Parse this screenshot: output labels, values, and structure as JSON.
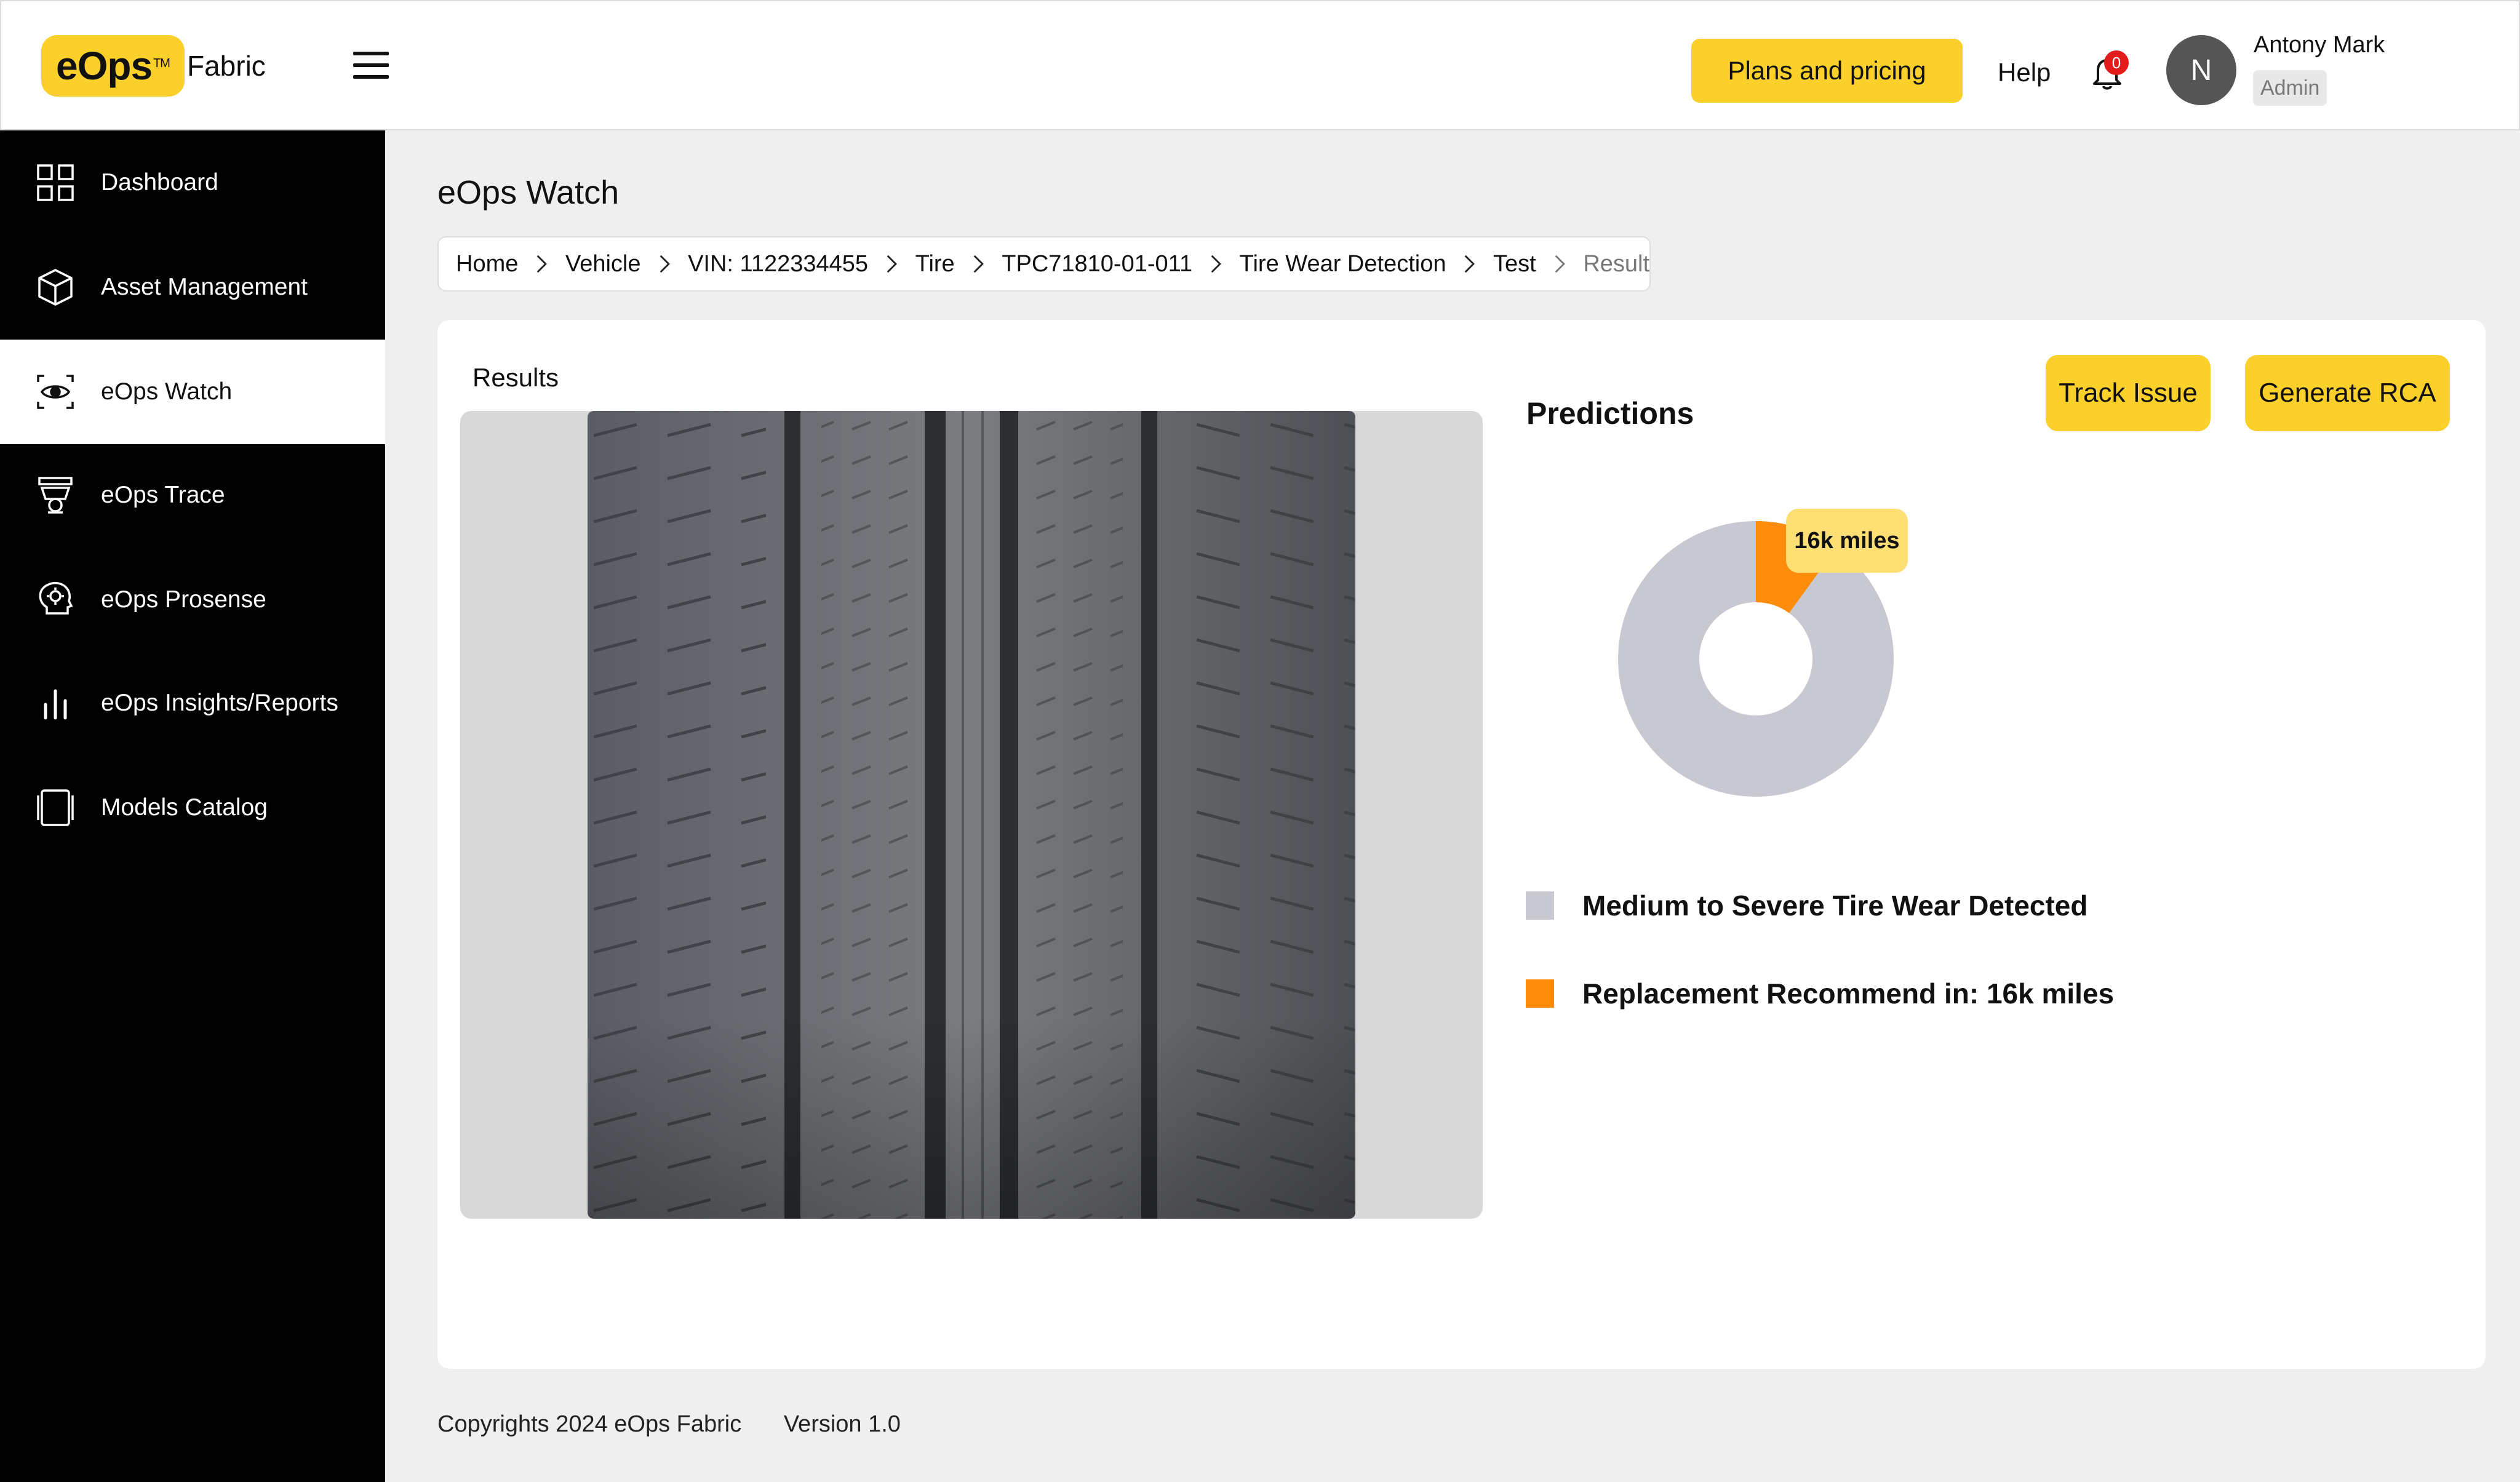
{
  "header": {
    "logo_text": "eOps",
    "logo_tm": "TM",
    "logo_suffix": "Fabric",
    "plans_label": "Plans and pricing",
    "help_label": "Help",
    "notification_count": "0",
    "user": {
      "initial": "N",
      "name": "Antony Mark",
      "role": "Admin"
    }
  },
  "sidebar": {
    "items": [
      {
        "label": "Dashboard",
        "icon": "grid-icon",
        "active": false
      },
      {
        "label": "Asset Management",
        "icon": "cube-icon",
        "active": false
      },
      {
        "label": "eOps Watch",
        "icon": "eye-scan-icon",
        "active": true
      },
      {
        "label": "eOps Trace",
        "icon": "trace-icon",
        "active": false
      },
      {
        "label": "eOps Prosense",
        "icon": "brain-icon",
        "active": false
      },
      {
        "label": "eOps Insights/Reports",
        "icon": "bar-chart-icon",
        "active": false
      },
      {
        "label": "Models Catalog",
        "icon": "catalog-icon",
        "active": false
      }
    ]
  },
  "main": {
    "page_title": "eOps Watch",
    "breadcrumb": [
      "Home",
      "Vehicle",
      "VIN: 1122334455",
      "Tire",
      "TPC71810-01-011",
      "Tire Wear Detection",
      "Test",
      "Result"
    ],
    "results_label": "Results",
    "predictions_title": "Predictions",
    "track_issue_label": "Track Issue",
    "generate_rca_label": "Generate RCA",
    "tooltip": "16k miles",
    "legend": [
      {
        "label": "Medium to Severe Tire Wear Detected",
        "color": "#c8c8d2"
      },
      {
        "label": "Replacement Recommend in: 16k miles",
        "color": "#fd8c0c"
      }
    ]
  },
  "chart_data": {
    "type": "pie",
    "variant": "donut",
    "series": [
      {
        "name": "Medium to Severe Tire Wear Detected",
        "value": 90,
        "color": "#c8c8d2"
      },
      {
        "name": "Replacement Recommend in: 16k miles",
        "value": 10,
        "color": "#fd8c0c"
      }
    ]
  },
  "footer": {
    "copyright": "Copyrights 2024 eOps Fabric",
    "version": "Version 1.0"
  },
  "colors": {
    "accent": "#fcd02b",
    "sidebar_bg": "#000000",
    "badge": "#e21b1b"
  }
}
